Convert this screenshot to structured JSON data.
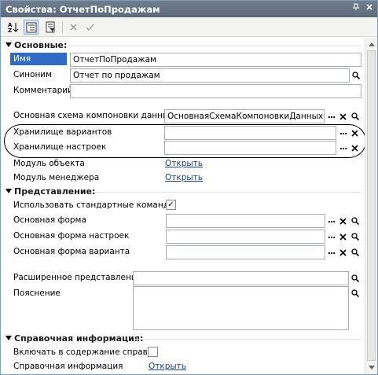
{
  "window": {
    "title": "Свойства: ОтчетПоПродажам",
    "pin_icon": "pin-icon",
    "close_icon": "close-icon"
  },
  "toolbar": {
    "sort_icon": "sort-alpha-icon",
    "categories_icon": "categories-icon",
    "filter_icon": "filter-icon",
    "clear_icon": "x-icon",
    "apply_icon": "check-icon"
  },
  "sections": {
    "main": "Основные:",
    "presentation": "Представление:",
    "help": "Справочная информация:"
  },
  "main": {
    "name_label": "Имя",
    "name_value": "ОтчетПоПродажам",
    "synonym_label": "Синоним",
    "synonym_value": "Отчет по продажам",
    "comment_label": "Комментарий",
    "comment_value": "",
    "schema_label": "Основная схема компоновки данных",
    "schema_value": "ОсновнаяСхемаКомпоновкиДанных",
    "variants_storage_label": "Хранилище вариантов",
    "variants_storage_value": "",
    "settings_storage_label": "Хранилище настроек",
    "settings_storage_value": "",
    "object_module_label": "Модуль объекта",
    "object_module_link": "Открыть",
    "manager_module_label": "Модуль менеджера",
    "manager_module_link": "Открыть"
  },
  "presentation": {
    "std_commands_label": "Использовать стандартные команды",
    "std_commands_checked": "✓",
    "main_form_label": "Основная форма",
    "main_settings_form_label": "Основная форма настроек",
    "main_variant_form_label": "Основная форма варианта",
    "extended_presentation_label": "Расширенное представление",
    "explanation_label": "Пояснение"
  },
  "help": {
    "include_label": "Включать в содержание справки",
    "info_label": "Справочная информация",
    "info_link": "Открыть"
  },
  "buttons": {
    "dots": "...",
    "clear": "✕"
  },
  "colors": {
    "selection": "#316ac5",
    "titlebar": "#6f7d8e",
    "link": "#1c3e7a"
  }
}
